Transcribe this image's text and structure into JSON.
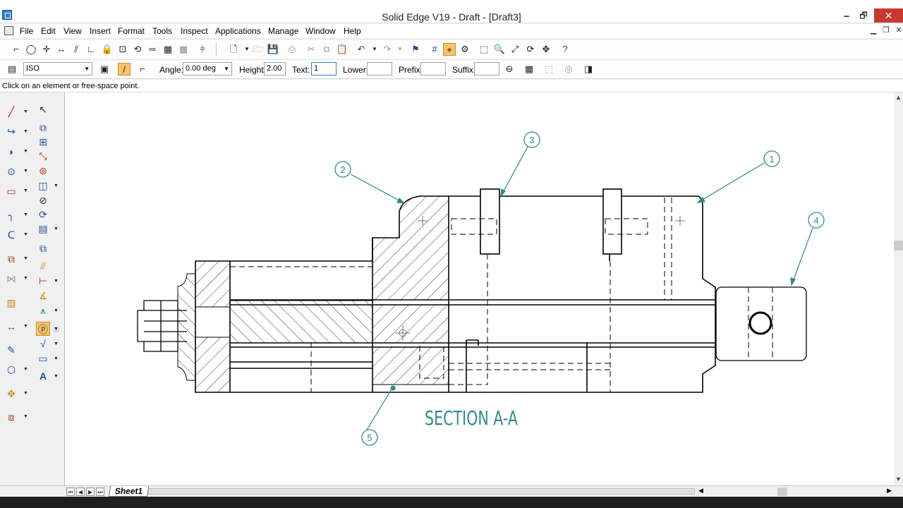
{
  "window": {
    "title": "Solid Edge V19 - Draft - [Draft3]",
    "minimize": "🗕",
    "maximize": "🗗",
    "close": "✕"
  },
  "menu": {
    "items": [
      "File",
      "Edit",
      "View",
      "Insert",
      "Format",
      "Tools",
      "Inspect",
      "Applications",
      "Manage",
      "Window",
      "Help"
    ]
  },
  "ribbon2": {
    "standard_value": "ISO",
    "angle_label": "Angle:",
    "angle_value": "0.00 deg",
    "height_label": "Height:",
    "height_value": "2.00",
    "text_label": "Text:",
    "text_value": "1",
    "lower_label": "Lower:",
    "lower_value": "",
    "prefix_label": "Prefix:",
    "prefix_value": "",
    "suffix_label": "Suffix:",
    "suffix_value": ""
  },
  "prompt": "Click on an element or free-space point.",
  "drawing": {
    "section_label": "SECTION A-A",
    "balloons": [
      "1",
      "2",
      "3",
      "4",
      "5"
    ],
    "line_color": "#000000",
    "balloon_color": "#2e8b88"
  },
  "sheet_tab": "Sheet1"
}
